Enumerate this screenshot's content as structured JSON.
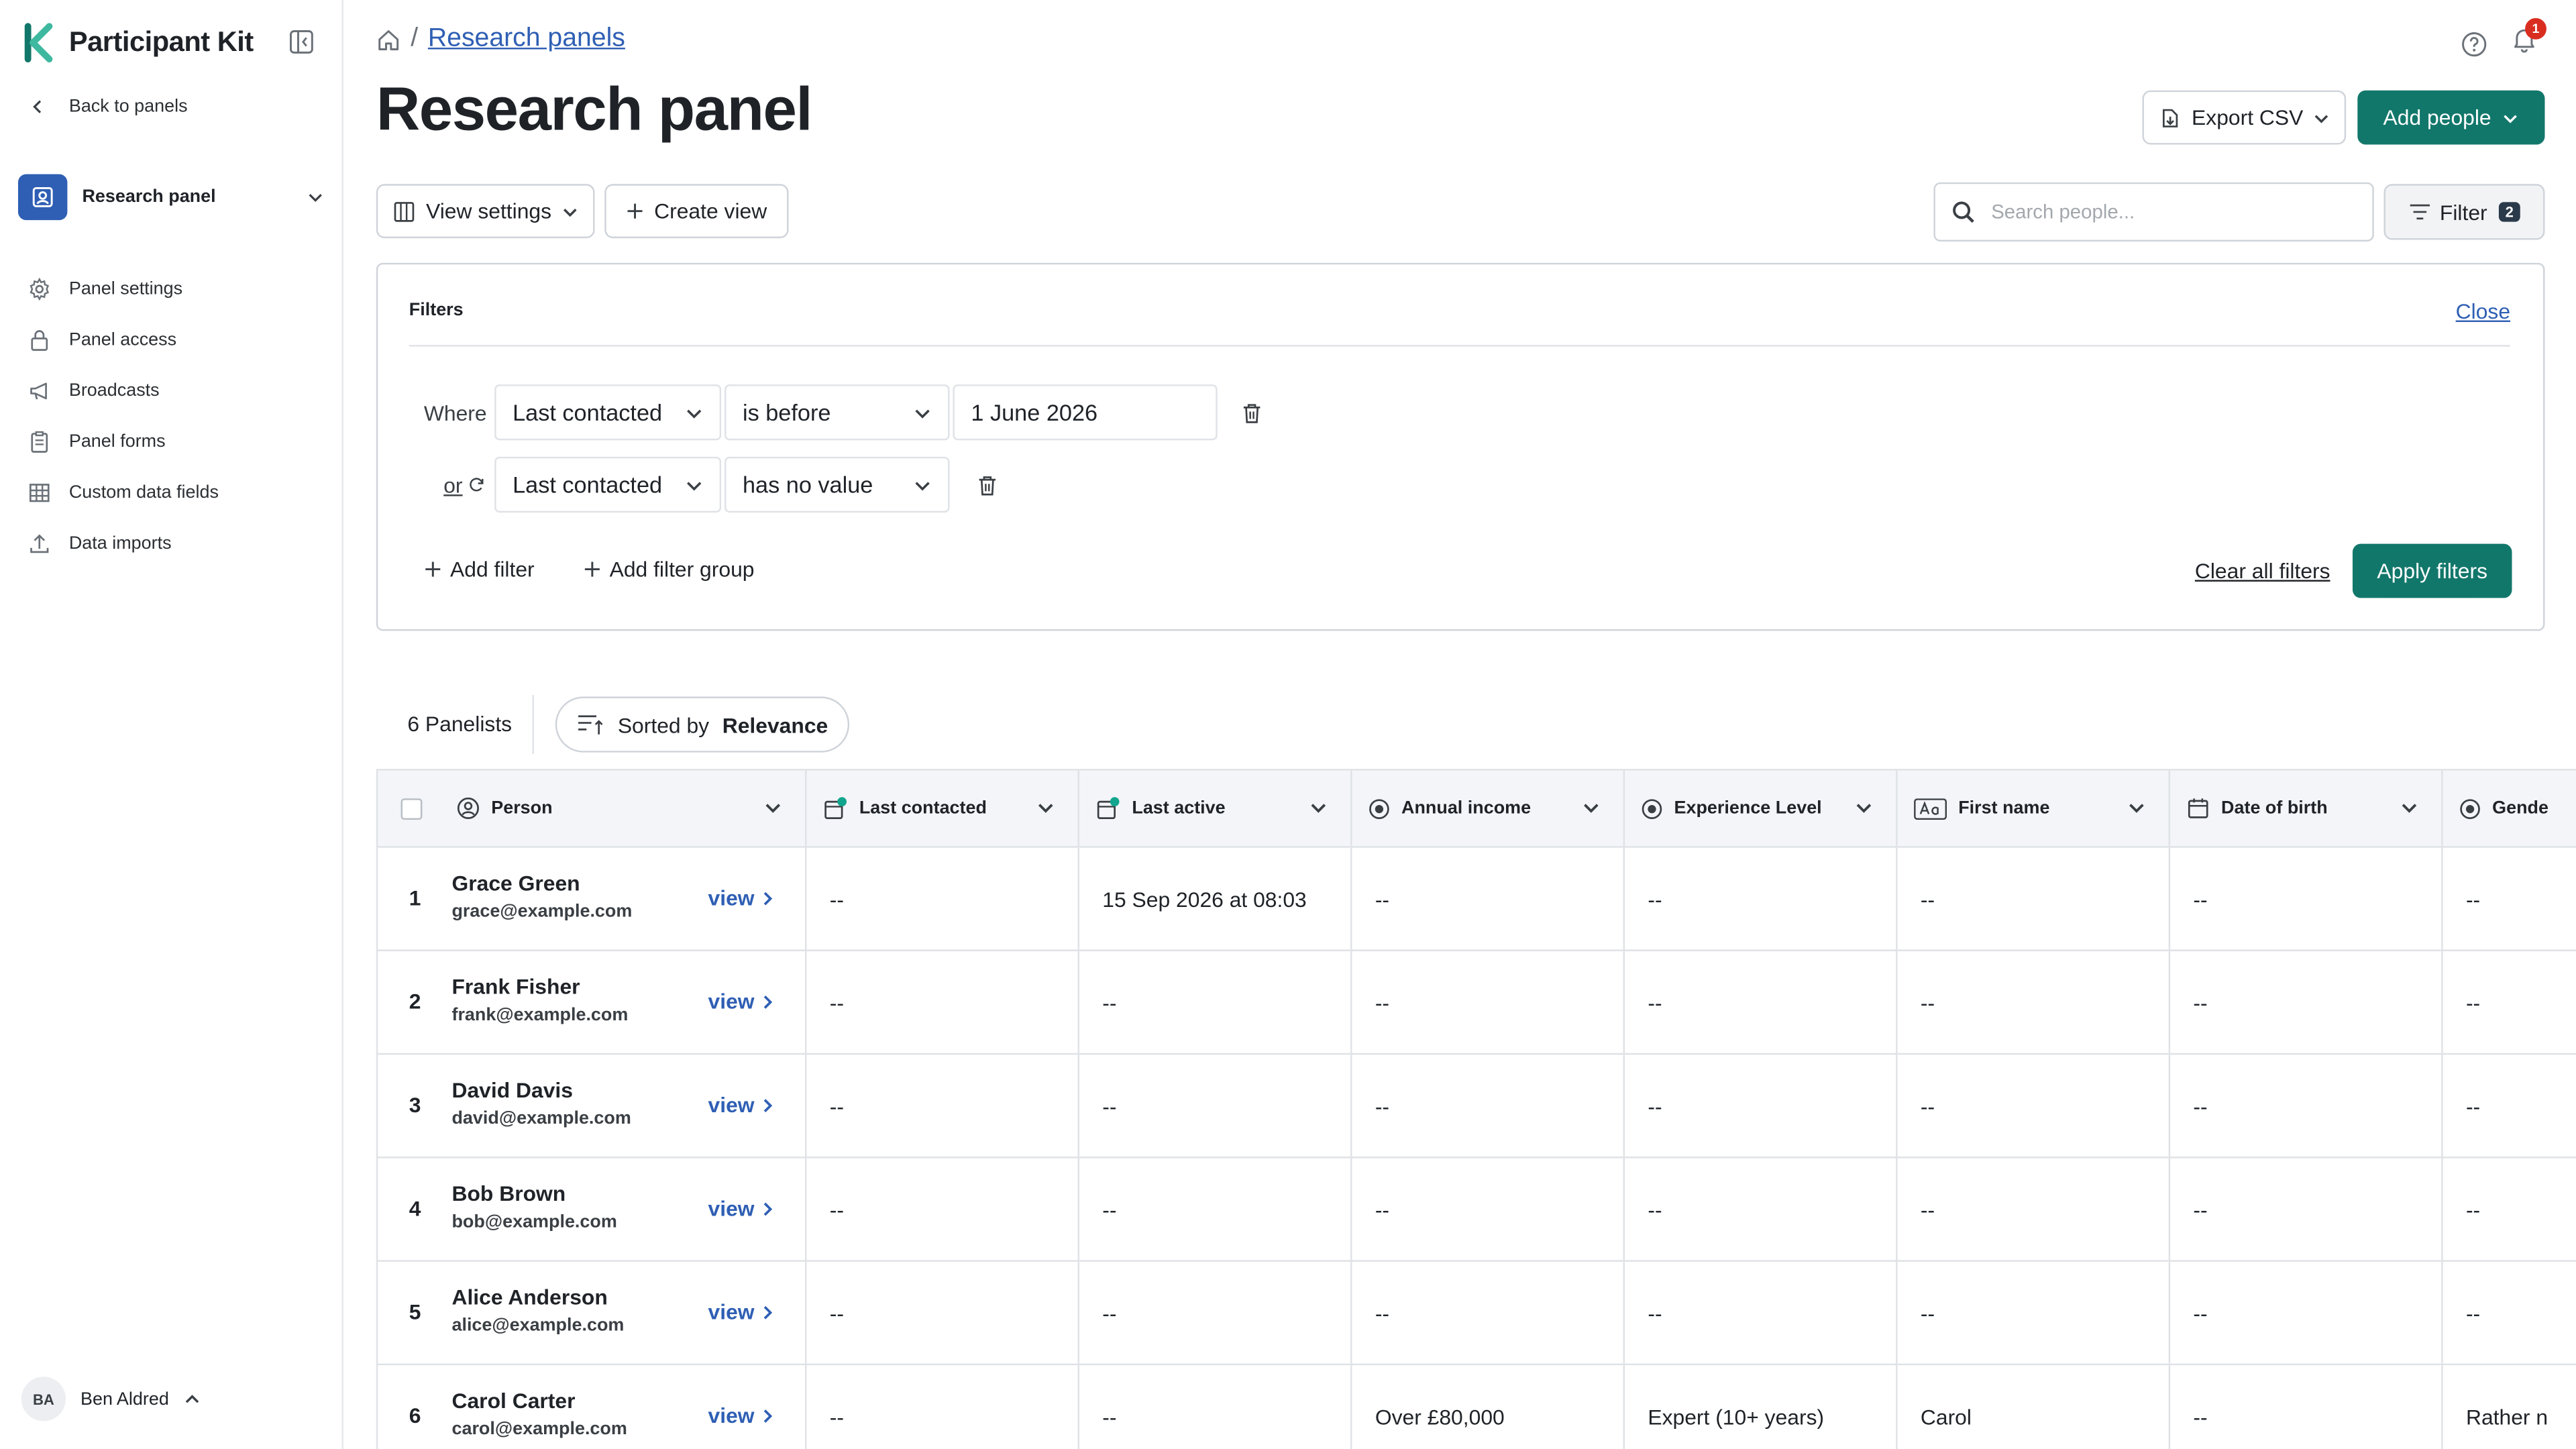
{
  "brand": {
    "name": "Participant Kit",
    "accent": "#12776b"
  },
  "sidebar": {
    "back_label": "Back to panels",
    "panel_name": "Research panel",
    "items": [
      {
        "label": "Panel settings",
        "icon": "gear-icon"
      },
      {
        "label": "Panel access",
        "icon": "lock-icon"
      },
      {
        "label": "Broadcasts",
        "icon": "megaphone-icon"
      },
      {
        "label": "Panel forms",
        "icon": "clipboard-icon"
      },
      {
        "label": "Custom data fields",
        "icon": "table-icon"
      },
      {
        "label": "Data imports",
        "icon": "upload-icon"
      }
    ],
    "user": {
      "initials": "BA",
      "name": "Ben Aldred"
    }
  },
  "header": {
    "breadcrumb_sep": "/",
    "breadcrumb_link": "Research panels",
    "notifications_count": "1",
    "title": "Research panel",
    "export_label": "Export CSV",
    "add_people_label": "Add people"
  },
  "toolbar": {
    "view_settings_label": "View settings",
    "create_view_label": "Create view",
    "search_placeholder": "Search people...",
    "filter_label": "Filter",
    "filter_count": "2"
  },
  "filters": {
    "title": "Filters",
    "close_label": "Close",
    "where_label": "Where",
    "or_label": "or",
    "rows": [
      {
        "field": "Last contacted",
        "operator": "is before",
        "value": "1 June 2026"
      },
      {
        "field": "Last contacted",
        "operator": "has no value"
      }
    ],
    "add_filter_label": "Add filter",
    "add_group_label": "Add filter group",
    "clear_label": "Clear all filters",
    "apply_label": "Apply filters"
  },
  "list": {
    "count_label": "6 Panelists",
    "sorted_prefix": "Sorted by",
    "sorted_value": "Relevance",
    "view_label": "view",
    "columns": [
      "Person",
      "Last contacted",
      "Last active",
      "Annual income",
      "Experience Level",
      "First name",
      "Date of birth",
      "Gende"
    ],
    "rows": [
      {
        "num": "1",
        "name": "Grace Green",
        "email": "grace@example.com",
        "cells": [
          "--",
          "15 Sep 2026 at 08:03",
          "--",
          "--",
          "--",
          "--",
          "--"
        ]
      },
      {
        "num": "2",
        "name": "Frank Fisher",
        "email": "frank@example.com",
        "cells": [
          "--",
          "--",
          "--",
          "--",
          "--",
          "--",
          "--"
        ]
      },
      {
        "num": "3",
        "name": "David Davis",
        "email": "david@example.com",
        "cells": [
          "--",
          "--",
          "--",
          "--",
          "--",
          "--",
          "--"
        ]
      },
      {
        "num": "4",
        "name": "Bob Brown",
        "email": "bob@example.com",
        "cells": [
          "--",
          "--",
          "--",
          "--",
          "--",
          "--",
          "--"
        ]
      },
      {
        "num": "5",
        "name": "Alice Anderson",
        "email": "alice@example.com",
        "cells": [
          "--",
          "--",
          "--",
          "--",
          "--",
          "--",
          "--"
        ]
      },
      {
        "num": "6",
        "name": "Carol Carter",
        "email": "carol@example.com",
        "cells": [
          "--",
          "--",
          "Over £80,000",
          "Expert (10+ years)",
          "Carol",
          "--",
          "Rather n"
        ]
      }
    ]
  }
}
